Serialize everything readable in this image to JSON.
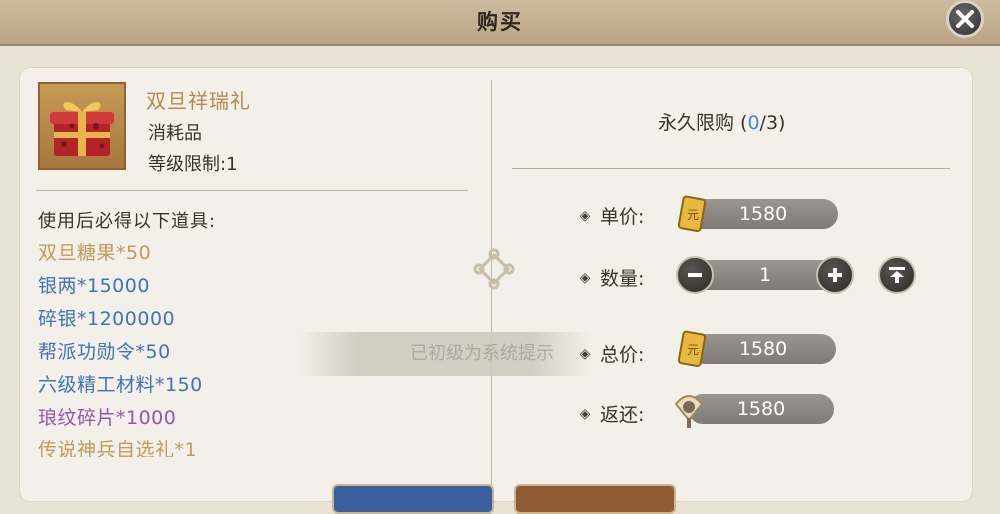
{
  "dialog": {
    "title": "购买"
  },
  "item": {
    "name": "双旦祥瑞礼",
    "type": "消耗品",
    "level_limit": "等级限制:1",
    "icon": "gift-box-icon"
  },
  "rewards": {
    "title": "使用后必得以下道具:",
    "items": [
      {
        "text": "双旦糖果*50",
        "color": "#c29a5a"
      },
      {
        "text": "银两*15000",
        "color": "#3f73b8"
      },
      {
        "text": "碎银*1200000",
        "color": "#3f73b8"
      },
      {
        "text": "帮派功勋令*50",
        "color": "#3f73b8"
      },
      {
        "text": "六级精工材料*150",
        "color": "#3f73b8"
      },
      {
        "text": "琅纹碎片*1000",
        "color": "#9b52b5"
      },
      {
        "text": "传说神兵自选礼*1",
        "color": "#c29a5a"
      }
    ]
  },
  "purchase": {
    "limit_prefix": "永久限购 (",
    "limit_current": "0",
    "limit_suffix": "/3)",
    "unit_price_label": "单价:",
    "unit_price": "1580",
    "quantity_label": "数量:",
    "quantity": "1",
    "total_label": "总价:",
    "total": "1580",
    "rebate_label": "返还:",
    "rebate": "1580"
  },
  "toast": {
    "text": "已初级为系统提示"
  },
  "colors": {
    "accent_blue": "#3e8ad6",
    "gold": "#c29a5a",
    "purple": "#9b52b5"
  }
}
